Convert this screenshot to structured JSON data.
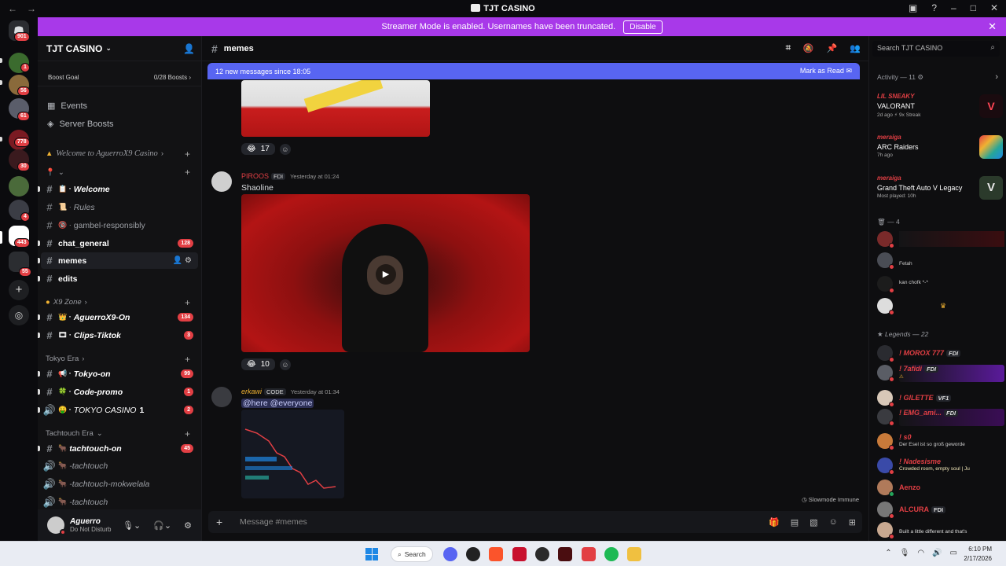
{
  "window": {
    "title": "TJT CASINO"
  },
  "banner": {
    "text": "Streamer Mode is enabled. Usernames have been truncated.",
    "button": "Disable"
  },
  "rail": {
    "badges": [
      "901",
      "1",
      "56",
      "61",
      "778",
      "30",
      "4",
      "443",
      "55"
    ]
  },
  "guild": {
    "name": "TJT CASINO",
    "boost_label": "Boost Goal",
    "boost_value": "0/28 Boosts",
    "nav": [
      "Events",
      "Server Boosts"
    ],
    "categories": [
      {
        "label": "Welcome to AguerroX9 Casino"
      },
      {
        "label": "X9 Zone"
      },
      {
        "label": "Tokyo Era"
      },
      {
        "label": "Tachtouch Era"
      }
    ],
    "channels": [
      {
        "name": "Welcome",
        "badge": ""
      },
      {
        "name": "Rules",
        "badge": ""
      },
      {
        "name": "gambel-responsibly",
        "badge": ""
      },
      {
        "name": "chat_general",
        "badge": "128"
      },
      {
        "name": "memes",
        "badge": ""
      },
      {
        "name": "edits",
        "badge": ""
      },
      {
        "name": "AguerroX9-On",
        "badge": "134"
      },
      {
        "name": "Clips-Tiktok",
        "badge": "3"
      },
      {
        "name": "Tokyo-on",
        "badge": "99"
      },
      {
        "name": "Code-promo",
        "badge": "1"
      },
      {
        "name": "TOKYO CASINO",
        "count": "1",
        "badge": "2"
      },
      {
        "name": "tachtouch-on",
        "badge": "45"
      },
      {
        "name": "-tachtouch",
        "badge": ""
      },
      {
        "name": "-tachtouch-mokwelala",
        "badge": ""
      },
      {
        "name": "-tachtouch",
        "badge": ""
      }
    ]
  },
  "user": {
    "name": "Aguerro",
    "status": "Do Not Disturb"
  },
  "chat": {
    "channel": "memes",
    "new_messages": "12 new messages since 18:05",
    "mark_read": "Mark as Read",
    "messages": [
      {
        "reaction_count": "17"
      },
      {
        "author": "PIROOS",
        "tag": "FDI",
        "time": "Yesterday at 01:24",
        "text": "Shaoline",
        "reaction_count": "10"
      },
      {
        "author": "erkawi",
        "tag": "CODE",
        "time": "Yesterday at 01:34",
        "text": "@here @everyone"
      }
    ],
    "composer_placeholder": "Message #memes",
    "slowmode": "Slowmode Immune"
  },
  "right": {
    "search_placeholder": "Search TJT CASINO",
    "activity_label": "Activity — 11",
    "activities": [
      {
        "who": "LIL SNEAKY",
        "game": "VALORANT",
        "meta": "2d ago  ⚡ 9x Streak"
      },
      {
        "who": "meraiga",
        "game": "ARC Raiders",
        "meta": "7h ago"
      },
      {
        "who": "meraiga",
        "game": "Grand Theft Auto V Legacy",
        "meta": "Most played: 10h"
      }
    ],
    "group_a": "— 4",
    "group_a_members": [
      {
        "name": "",
        "sub": ""
      },
      {
        "name": "",
        "sub": "Fetah"
      },
      {
        "name": "",
        "sub": "kan chofk *-*"
      },
      {
        "name": "",
        "sub": ""
      }
    ],
    "group_b": "Legends — 22",
    "legends": [
      {
        "name": "! MOROX 777",
        "tag": "FDI",
        "sub": ""
      },
      {
        "name": "! 7afidi",
        "tag": "FDI",
        "sub": ""
      },
      {
        "name": "! GILETTE",
        "tag": "VF1",
        "sub": ""
      },
      {
        "name": "! EMG_ami...",
        "tag": "FDI",
        "sub": ""
      },
      {
        "name": "! s0",
        "tag": "",
        "sub": "Der Esel ist so groß geworde"
      },
      {
        "name": "! Nadesisme",
        "tag": "",
        "sub": "Crowded room, empty soul | Ju"
      },
      {
        "name": "Aenzo",
        "tag": "",
        "sub": ""
      },
      {
        "name": "ALCURA",
        "tag": "FDI",
        "sub": ""
      },
      {
        "name": "",
        "tag": "",
        "sub": "Built a little different and that's"
      }
    ]
  },
  "taskbar": {
    "search": "Search",
    "time": "6:10 PM",
    "date": "2/17/2026"
  },
  "colors": {
    "banner": "#a839e9",
    "blurple": "#5865f2",
    "danger": "#e23f44"
  }
}
